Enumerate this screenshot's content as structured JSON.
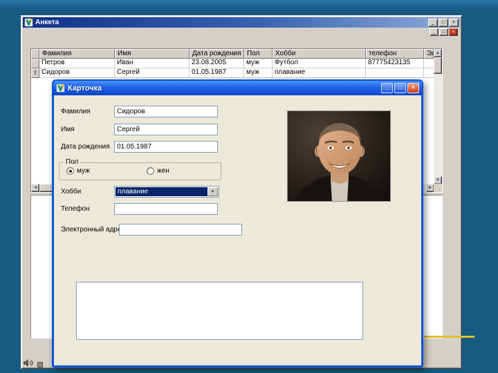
{
  "slide": {
    "bg_color": "#175a82",
    "accent_line_color": "#e2bf2d"
  },
  "icons": {
    "app": "app-icon",
    "minimize": "_",
    "maximize": "□",
    "close": "×",
    "up_arrow": "▲",
    "down_arrow": "▼",
    "left_arrow": "◄",
    "right_arrow": "►",
    "dropdown_arrow": "▼",
    "row_marker": "I"
  },
  "main_window": {
    "title": "Анкета",
    "grid": {
      "headers": [
        "Фамилия",
        "Имя",
        "Дата рождения",
        "Пол",
        "Хобби",
        "телефон",
        "Элект"
      ],
      "rows": [
        [
          "Петров",
          "Иван",
          "23.08.2005",
          "муж",
          "Футбол",
          "87775423135",
          ""
        ],
        [
          "Сидоров",
          "Сергей",
          "01.05.1987",
          "муж",
          "плавание",
          "",
          ""
        ]
      ]
    }
  },
  "dialog": {
    "title": "Карточка",
    "fields": {
      "surname": {
        "label": "Фамилия",
        "value": "Сидоров"
      },
      "firstname": {
        "label": "Имя",
        "value": "Сергей"
      },
      "birthdate": {
        "label": "Дата рождения",
        "value": "01.05.1987"
      },
      "sex": {
        "label": "Пол",
        "options": [
          {
            "label": "муж",
            "selected": true
          },
          {
            "label": "жен",
            "selected": false
          }
        ]
      },
      "hobby": {
        "label": "Хобби",
        "value": "плавание"
      },
      "phone": {
        "label": "Телефон",
        "value": ""
      },
      "email": {
        "label": "Электронный адрес",
        "value": ""
      }
    },
    "photo": "portrait-photo"
  }
}
